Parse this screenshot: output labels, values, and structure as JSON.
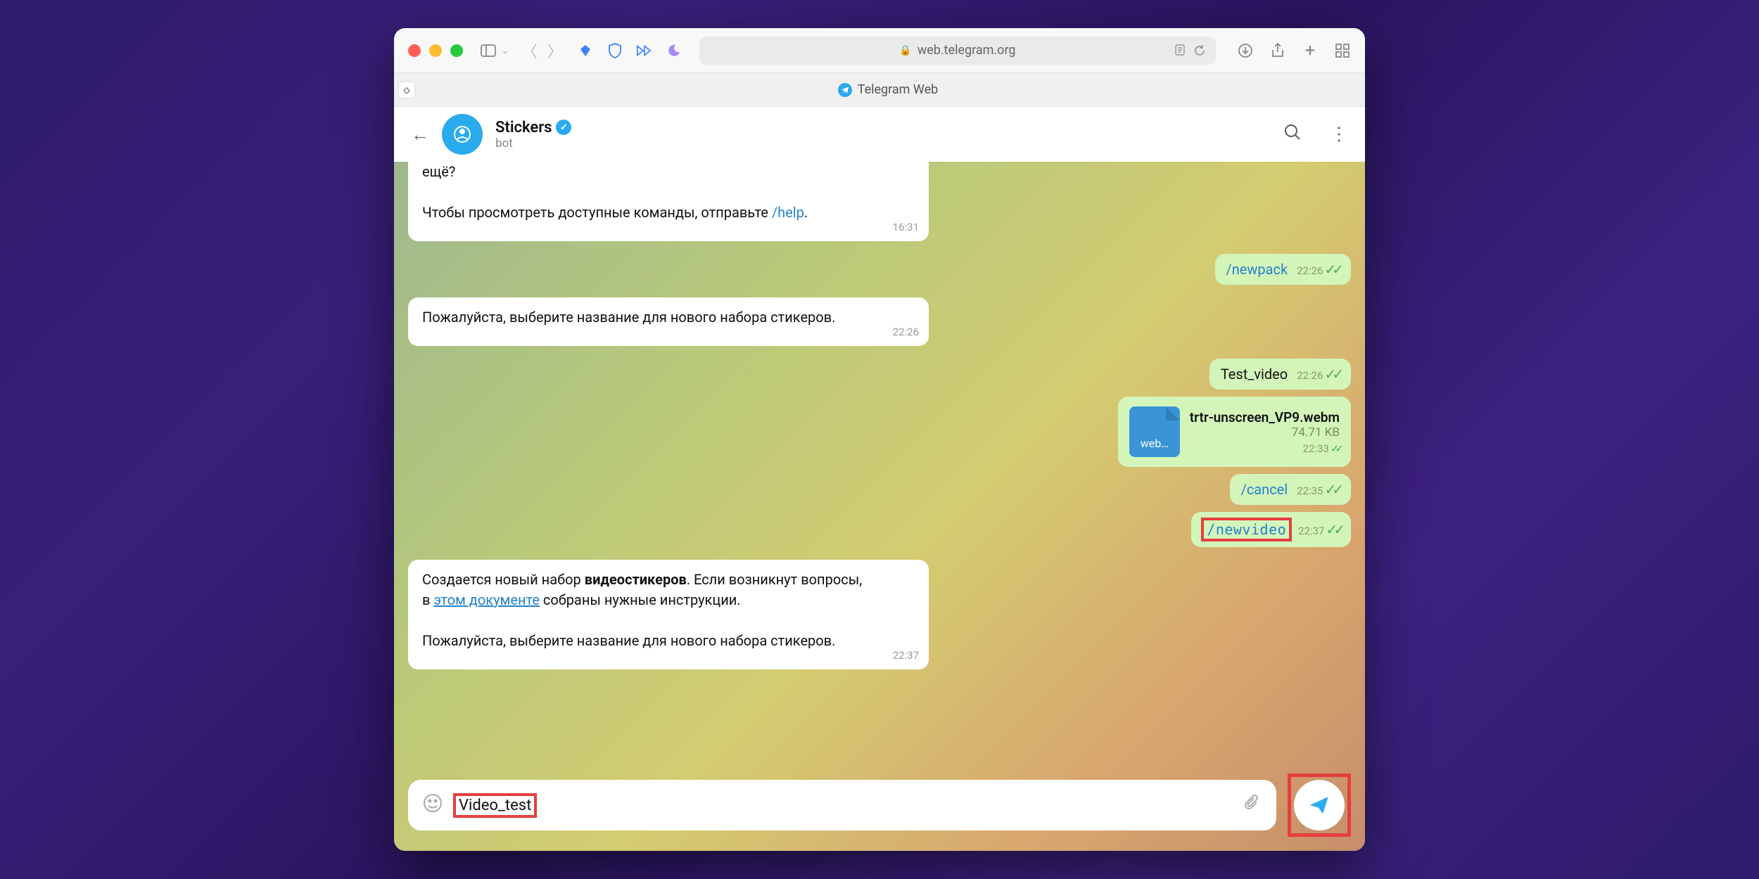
{
  "browser": {
    "url": "web.telegram.org",
    "tab_title": "Telegram Web"
  },
  "chat": {
    "name": "Stickers",
    "subtitle": "bot"
  },
  "messages": {
    "m1": {
      "frag": "ещё?",
      "line2a": "Чтобы просмотреть доступные команды, отправьте ",
      "line2b": "/help",
      "line2c": ".",
      "time": "16:31"
    },
    "m2": {
      "text": "/newpack",
      "time": "22:26"
    },
    "m3": {
      "text": "Пожалуйста, выберите название для нового набора стикеров.",
      "time": "22:26"
    },
    "m4": {
      "text": "Test_video",
      "time": "22:26"
    },
    "m5": {
      "name": "trtr-unscreen_VP9.webm",
      "size": "74.71 KB",
      "ext": "web…",
      "time": "22:33"
    },
    "m6": {
      "text": "/cancel",
      "time": "22:35"
    },
    "m7": {
      "text": "/newvideo",
      "time": "22:37"
    },
    "m8": {
      "p1a": "Создается новый набор ",
      "p1b": "видеостикеров",
      "p1c": ". Если возникнут вопросы, в ",
      "p1d": "этом документе",
      "p1e": " собраны нужные инструкции.",
      "p2": "Пожалуйста, выберите название для нового набора стикеров.",
      "time": "22:37"
    }
  },
  "input": {
    "text": "Video_test"
  }
}
